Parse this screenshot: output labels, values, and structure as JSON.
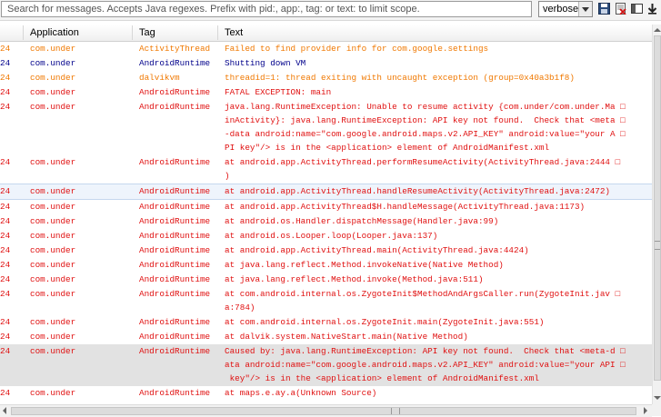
{
  "search": {
    "placeholder": "Search for messages. Accepts Java regexes. Prefix with pid:, app:, tag: or text: to limit scope."
  },
  "log_level": {
    "selected": "verbose"
  },
  "toolbar_icons": [
    "save-icon",
    "clear-log-icon",
    "toggle-panel-icon",
    "scroll-lock-icon"
  ],
  "columns": {
    "application": "Application",
    "tag": "Tag",
    "text": "Text"
  },
  "level_colors": {
    "error": "#e01010",
    "debug": "#00008b",
    "warn": "#f07800",
    "dalvik": "#f07800"
  },
  "rows": [
    {
      "time": "24",
      "app": "com.under",
      "tag": "ActivityThread",
      "level": "warn",
      "lines": [
        "Failed to find provider info for com.google.settings"
      ]
    },
    {
      "time": "24",
      "app": "com.under",
      "tag": "AndroidRuntime",
      "level": "debug",
      "lines": [
        "Shutting down VM"
      ]
    },
    {
      "time": "24",
      "app": "com.under",
      "tag": "dalvikvm",
      "level": "dalvik",
      "lines": [
        "threadid=1: thread exiting with uncaught exception (group=0x40a3b1f8)"
      ]
    },
    {
      "time": "24",
      "app": "com.under",
      "tag": "AndroidRuntime",
      "level": "error",
      "lines": [
        "FATAL EXCEPTION: main"
      ]
    },
    {
      "time": "24",
      "app": "com.under",
      "tag": "AndroidRuntime",
      "level": "error",
      "lines": [
        "java.lang.RuntimeException: Unable to resume activity {com.under/com.under.Ma □",
        "inActivity}: java.lang.RuntimeException: API key not found.  Check that <meta □",
        "-data android:name=\"com.google.android.maps.v2.API_KEY\" android:value=\"your A □",
        "PI key\"/> is in the <application> element of AndroidManifest.xml"
      ]
    },
    {
      "time": "24",
      "app": "com.under",
      "tag": "AndroidRuntime",
      "level": "error",
      "lines": [
        "at android.app.ActivityThread.performResumeActivity(ActivityThread.java:2444 □",
        ")"
      ]
    },
    {
      "time": "24",
      "app": "com.under",
      "tag": "AndroidRuntime",
      "level": "error",
      "selected": true,
      "lines": [
        "at android.app.ActivityThread.handleResumeActivity(ActivityThread.java:2472)"
      ]
    },
    {
      "time": "24",
      "app": "com.under",
      "tag": "AndroidRuntime",
      "level": "error",
      "lines": [
        "at android.app.ActivityThread$H.handleMessage(ActivityThread.java:1173)"
      ]
    },
    {
      "time": "24",
      "app": "com.under",
      "tag": "AndroidRuntime",
      "level": "error",
      "lines": [
        "at android.os.Handler.dispatchMessage(Handler.java:99)"
      ]
    },
    {
      "time": "24",
      "app": "com.under",
      "tag": "AndroidRuntime",
      "level": "error",
      "lines": [
        "at android.os.Looper.loop(Looper.java:137)"
      ]
    },
    {
      "time": "24",
      "app": "com.under",
      "tag": "AndroidRuntime",
      "level": "error",
      "lines": [
        "at android.app.ActivityThread.main(ActivityThread.java:4424)"
      ]
    },
    {
      "time": "24",
      "app": "com.under",
      "tag": "AndroidRuntime",
      "level": "error",
      "lines": [
        "at java.lang.reflect.Method.invokeNative(Native Method)"
      ]
    },
    {
      "time": "24",
      "app": "com.under",
      "tag": "AndroidRuntime",
      "level": "error",
      "lines": [
        "at java.lang.reflect.Method.invoke(Method.java:511)"
      ]
    },
    {
      "time": "24",
      "app": "com.under",
      "tag": "AndroidRuntime",
      "level": "error",
      "lines": [
        "at com.android.internal.os.ZygoteInit$MethodAndArgsCaller.run(ZygoteInit.jav □",
        "a:784)"
      ]
    },
    {
      "time": "24",
      "app": "com.under",
      "tag": "AndroidRuntime",
      "level": "error",
      "lines": [
        "at com.android.internal.os.ZygoteInit.main(ZygoteInit.java:551)"
      ]
    },
    {
      "time": "24",
      "app": "com.under",
      "tag": "AndroidRuntime",
      "level": "error",
      "lines": [
        "at dalvik.system.NativeStart.main(Native Method)"
      ]
    },
    {
      "time": "24",
      "app": "com.under",
      "tag": "AndroidRuntime",
      "level": "error",
      "highlight": true,
      "lines": [
        "Caused by: java.lang.RuntimeException: API key not found.  Check that <meta-d □",
        "ata android:name=\"com.google.android.maps.v2.API_KEY\" android:value=\"your API □",
        " key\"/> is in the <application> element of AndroidManifest.xml"
      ]
    },
    {
      "time": "24",
      "app": "com.under",
      "tag": "AndroidRuntime",
      "level": "error",
      "lines": [
        "at maps.e.ay.a(Unknown Source)"
      ]
    }
  ]
}
